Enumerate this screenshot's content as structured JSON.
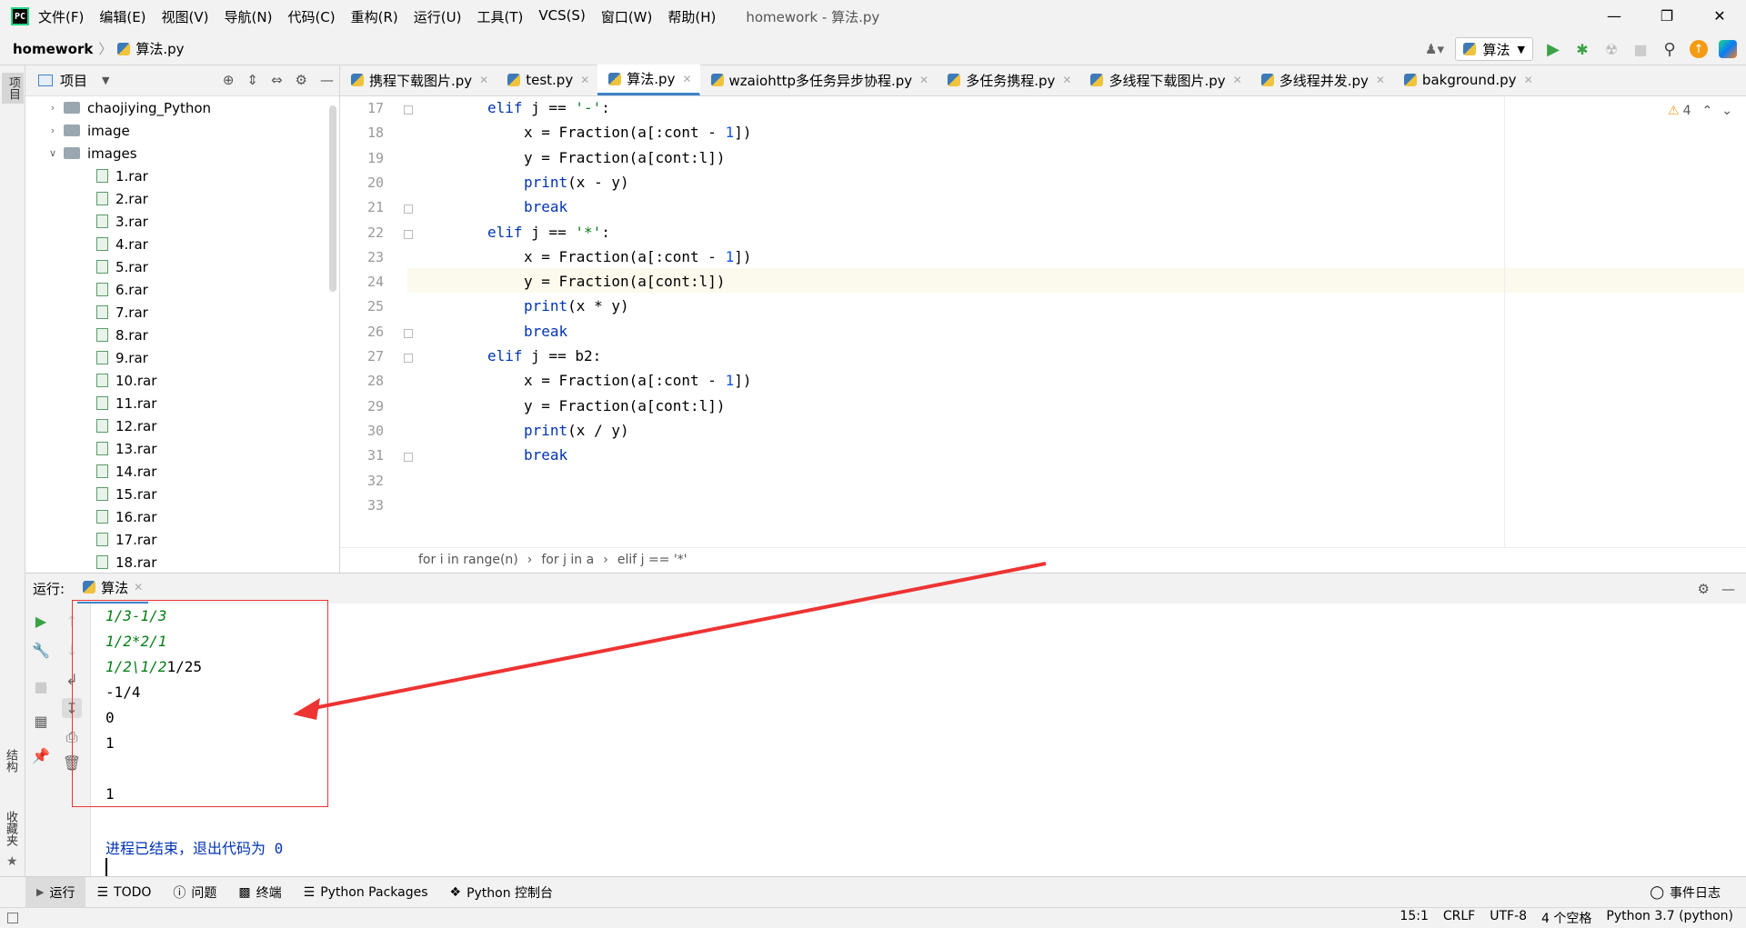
{
  "window": {
    "menu": [
      "文件(F)",
      "编辑(E)",
      "视图(V)",
      "导航(N)",
      "代码(C)",
      "重构(R)",
      "运行(U)",
      "工具(T)",
      "VCS(S)",
      "窗口(W)",
      "帮助(H)"
    ],
    "title": "homework - 算法.py"
  },
  "nav": {
    "project": "homework",
    "file": "算法.py",
    "run_config": "算法"
  },
  "left_tabs": {
    "project": "项目",
    "structure": "结构",
    "favorites": "收藏夹"
  },
  "project_panel": {
    "title": "项目",
    "tree": [
      {
        "label": "chaojiying_Python",
        "type": "folder",
        "open": false
      },
      {
        "label": "image",
        "type": "folder",
        "open": false
      },
      {
        "label": "images",
        "type": "folder",
        "open": true
      },
      {
        "label": "1.rar",
        "type": "file"
      },
      {
        "label": "2.rar",
        "type": "file"
      },
      {
        "label": "3.rar",
        "type": "file"
      },
      {
        "label": "4.rar",
        "type": "file"
      },
      {
        "label": "5.rar",
        "type": "file"
      },
      {
        "label": "6.rar",
        "type": "file"
      },
      {
        "label": "7.rar",
        "type": "file"
      },
      {
        "label": "8.rar",
        "type": "file"
      },
      {
        "label": "9.rar",
        "type": "file"
      },
      {
        "label": "10.rar",
        "type": "file"
      },
      {
        "label": "11.rar",
        "type": "file"
      },
      {
        "label": "12.rar",
        "type": "file"
      },
      {
        "label": "13.rar",
        "type": "file"
      },
      {
        "label": "14.rar",
        "type": "file"
      },
      {
        "label": "15.rar",
        "type": "file"
      },
      {
        "label": "16.rar",
        "type": "file"
      },
      {
        "label": "17.rar",
        "type": "file"
      },
      {
        "label": "18.rar",
        "type": "file"
      }
    ]
  },
  "tabs": [
    {
      "label": "携程下载图片.py",
      "active": false
    },
    {
      "label": "test.py",
      "active": false
    },
    {
      "label": "算法.py",
      "active": true
    },
    {
      "label": "wzaiohttp多任务异步协程.py",
      "active": false
    },
    {
      "label": "多任务携程.py",
      "active": false
    },
    {
      "label": "多线程下载图片.py",
      "active": false
    },
    {
      "label": "多线程并发.py",
      "active": false
    },
    {
      "label": "bakground.py",
      "active": false
    }
  ],
  "editor": {
    "warnings": "4",
    "lines": [
      {
        "n": "17",
        "code": "elif j == '-':"
      },
      {
        "n": "18",
        "code": "x = Fraction(a[:cont - 1])"
      },
      {
        "n": "19",
        "code": "y = Fraction(a[cont:l])"
      },
      {
        "n": "20",
        "code": "print(x - y)"
      },
      {
        "n": "21",
        "code": "break"
      },
      {
        "n": "22",
        "code": "elif j == '*':"
      },
      {
        "n": "23",
        "code": "x = Fraction(a[:cont - 1])"
      },
      {
        "n": "24",
        "code": "y = Fraction(a[cont:l])"
      },
      {
        "n": "25",
        "code": "print(x * y)"
      },
      {
        "n": "26",
        "code": "break"
      },
      {
        "n": "27",
        "code": "elif j == b2:"
      },
      {
        "n": "28",
        "code": "x = Fraction(a[:cont - 1])"
      },
      {
        "n": "29",
        "code": "y = Fraction(a[cont:l])"
      },
      {
        "n": "30",
        "code": "print(x / y)"
      },
      {
        "n": "31",
        "code": "break"
      },
      {
        "n": "32",
        "code": ""
      },
      {
        "n": "33",
        "code": ""
      }
    ],
    "breadcrumbs": [
      "for i in range(n)",
      "for j in a",
      "elif j == '*'"
    ]
  },
  "run": {
    "label": "运行:",
    "tab": "算法",
    "output": [
      "1/3-1/3",
      "1/2*2/1",
      "1/2\\1/21/25",
      "-1/4",
      "0",
      "1",
      "",
      "1",
      "",
      "进程已结束，退出代码为 0"
    ]
  },
  "bottom_tabs": [
    "运行",
    "TODO",
    "问题",
    "终端",
    "Python Packages",
    "Python 控制台"
  ],
  "event_log": "事件日志",
  "status": {
    "position": "15:1",
    "line_sep": "CRLF",
    "encoding": "UTF-8",
    "indent": "4 个空格",
    "interpreter": "Python 3.7 (python)"
  }
}
